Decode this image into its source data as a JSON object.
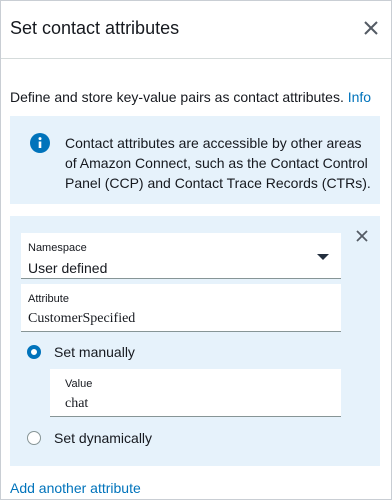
{
  "header": {
    "title": "Set contact attributes",
    "close_icon": "close-icon"
  },
  "description": {
    "text": "Define and store key-value pairs as contact attributes.",
    "link_label": "Info"
  },
  "info_box": {
    "icon": "info-icon",
    "text": "Contact attributes are accessible by other areas of Amazon Connect, such as the Contact Control Panel (CCP) and Contact Trace Records (CTRs)."
  },
  "attribute": {
    "namespace": {
      "label": "Namespace",
      "value": "User defined"
    },
    "key": {
      "label": "Attribute",
      "value": "CustomerSpecified"
    },
    "set_manually": {
      "label": "Set manually",
      "selected": true
    },
    "value_field": {
      "label": "Value",
      "value": "chat"
    },
    "set_dynamically": {
      "label": "Set dynamically",
      "selected": false
    }
  },
  "add_link": "Add another attribute",
  "colors": {
    "accent": "#0073bb",
    "info_background": "#e6f2fb",
    "text": "#16191f"
  }
}
